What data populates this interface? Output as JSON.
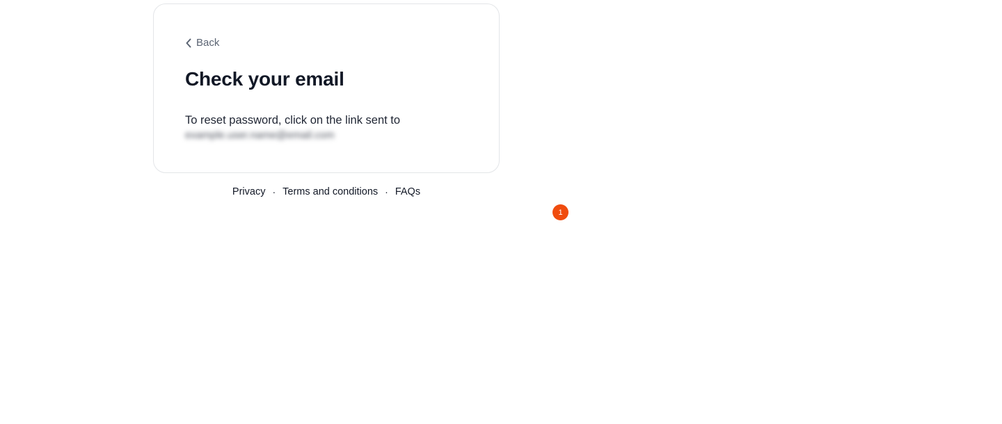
{
  "card": {
    "back_label": "Back",
    "title": "Check your email",
    "description": "To reset password, click on the link sent to",
    "email_masked": "example.user.name@email.com"
  },
  "footer": {
    "links": {
      "privacy": "Privacy",
      "terms": "Terms and conditions",
      "faqs": "FAQs"
    },
    "separator": "·"
  },
  "badge": {
    "count": "1",
    "color": "#f04c0e"
  },
  "icons": {
    "back": "chevron-left-icon"
  }
}
